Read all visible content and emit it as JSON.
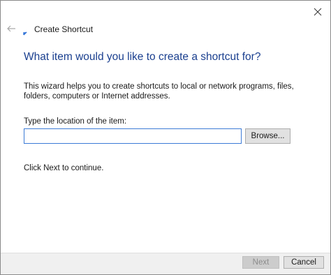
{
  "window": {
    "close_icon": "close-icon"
  },
  "header": {
    "back_icon": "back-arrow-icon",
    "wizard_icon": "shortcut-icon",
    "title": "Create Shortcut"
  },
  "main": {
    "heading": "What item would you like to create a shortcut for?",
    "description": "This wizard helps you to create shortcuts to local or network programs, files, folders, computers or Internet addresses.",
    "location_label": "Type the location of the item:",
    "location_value": "",
    "browse_label": "Browse...",
    "continue_text": "Click Next to continue."
  },
  "footer": {
    "next_label": "Next",
    "next_enabled": false,
    "cancel_label": "Cancel"
  },
  "colors": {
    "heading": "#1a3f8f",
    "input_focus_border": "#3c7bd6",
    "footer_bg": "#f0f0f0",
    "disabled_button_bg": "#cccccc"
  }
}
